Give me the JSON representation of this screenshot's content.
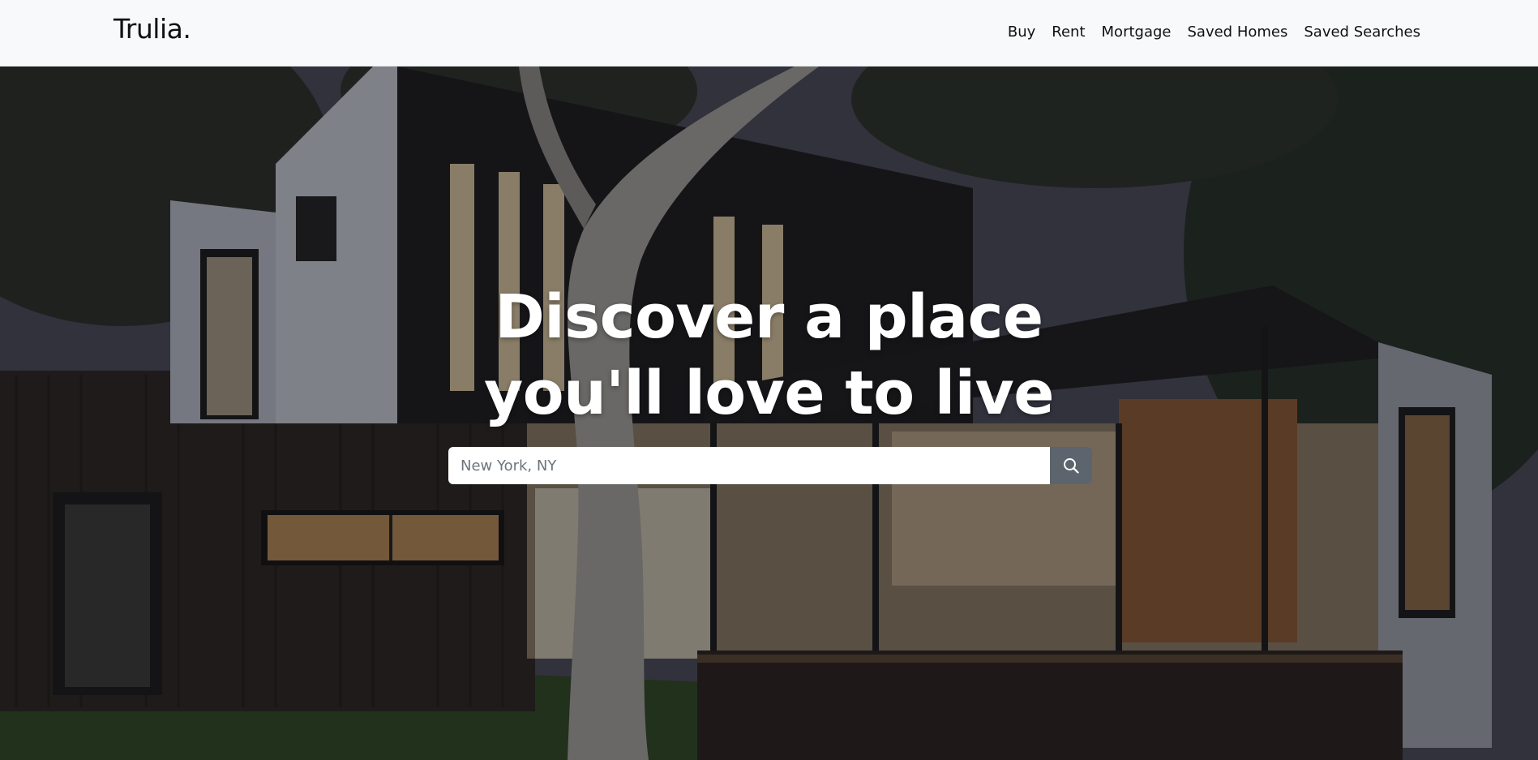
{
  "navbar": {
    "brand": "Trulia.",
    "links": [
      "Buy",
      "Rent",
      "Mortgage",
      "Saved Homes",
      "Saved Searches"
    ]
  },
  "hero": {
    "headline_line1": "Discover a place",
    "headline_line2": "you'll love to live",
    "search": {
      "placeholder": "New York, NY",
      "value": "",
      "button_icon": "search-icon"
    }
  },
  "colors": {
    "navbar_bg": "#f8f9fa",
    "search_button_bg": "#5c646d",
    "headline_color": "#ffffff"
  }
}
